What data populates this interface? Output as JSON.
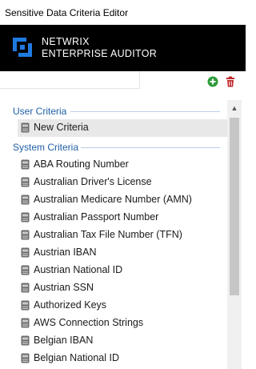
{
  "window": {
    "title": "Sensitive Data Criteria Editor"
  },
  "brand": {
    "line1": "NETWRIX",
    "line2": "ENTERPRISE AUDITOR",
    "logo_color": "#1f7ae0"
  },
  "toolbar": {
    "add_icon": "add-icon",
    "delete_icon": "delete-icon",
    "add_color": "#2e9b3a",
    "delete_color": "#c0282c"
  },
  "groups": [
    {
      "label": "User Criteria",
      "items": [
        {
          "label": "New Criteria",
          "selected": true
        }
      ]
    },
    {
      "label": "System Criteria",
      "items": [
        {
          "label": "ABA Routing Number"
        },
        {
          "label": "Australian Driver's License"
        },
        {
          "label": "Australian Medicare Number (AMN)"
        },
        {
          "label": "Australian Passport Number"
        },
        {
          "label": "Australian Tax File Number (TFN)"
        },
        {
          "label": "Austrian IBAN"
        },
        {
          "label": "Austrian National ID"
        },
        {
          "label": "Austrian SSN"
        },
        {
          "label": "Authorized Keys"
        },
        {
          "label": "AWS Connection Strings"
        },
        {
          "label": "Belgian IBAN"
        },
        {
          "label": "Belgian National ID"
        }
      ]
    }
  ],
  "colors": {
    "group_heading": "#1f5fa6",
    "selected_row": "#e8e8e8",
    "brand_bg": "#000000"
  }
}
